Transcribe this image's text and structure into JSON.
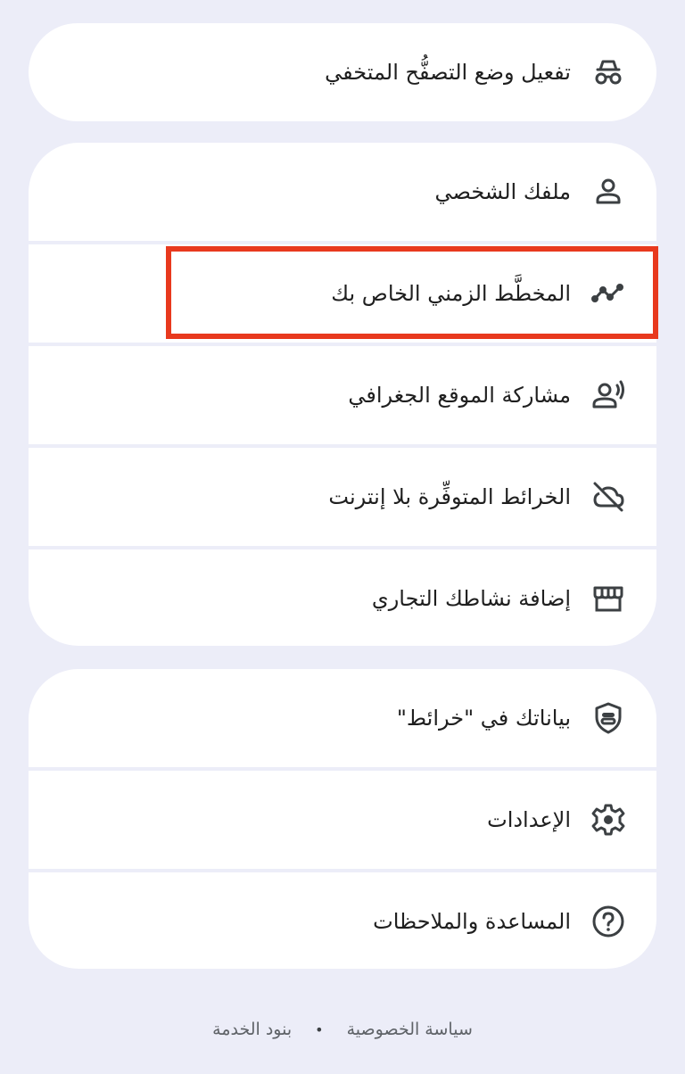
{
  "incognito": {
    "label": "تفعيل وضع التصفُّح المتخفي",
    "icon": "incognito-icon"
  },
  "menu": [
    {
      "label": "ملفك الشخصي",
      "icon": "person-icon"
    },
    {
      "label": "المخطَّط الزمني الخاص بك",
      "icon": "timeline-icon"
    },
    {
      "label": "مشاركة الموقع الجغرافي",
      "icon": "location-sharing-icon"
    },
    {
      "label": "الخرائط المتوفِّرة بلا إنترنت",
      "icon": "offline-cloud-icon"
    },
    {
      "label": "إضافة نشاطك التجاري",
      "icon": "storefront-icon"
    }
  ],
  "menu2": [
    {
      "label": "بياناتك في \"خرائط\"",
      "icon": "shield-data-icon"
    },
    {
      "label": "الإعدادات",
      "icon": "gear-icon"
    },
    {
      "label": "المساعدة والملاحظات",
      "icon": "help-icon"
    }
  ],
  "footer": {
    "privacy": "سياسة الخصوصية",
    "separator": "•",
    "terms": "بنود الخدمة"
  },
  "colors": {
    "background": "#ecedf8",
    "card": "#ffffff",
    "highlight": "#e8391e"
  }
}
